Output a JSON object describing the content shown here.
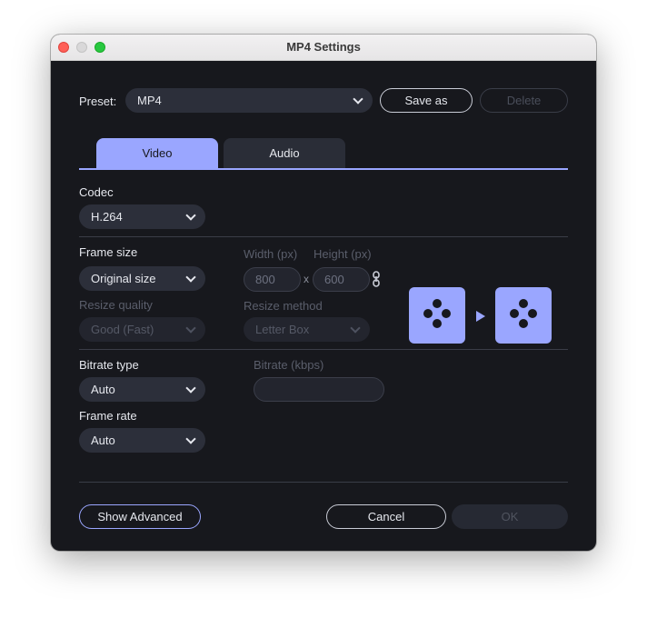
{
  "window": {
    "title": "MP4 Settings"
  },
  "preset": {
    "label": "Preset:",
    "value": "MP4",
    "save_as": "Save as",
    "delete": "Delete"
  },
  "tabs": [
    {
      "label": "Video",
      "active": true
    },
    {
      "label": "Audio",
      "active": false
    }
  ],
  "codec": {
    "label": "Codec",
    "value": "H.264"
  },
  "frame_size": {
    "label": "Frame size",
    "value": "Original size",
    "width_label": "Width (px)",
    "height_label": "Height (px)",
    "width": "800",
    "times": "x",
    "height": "600"
  },
  "resize_quality": {
    "label": "Resize quality",
    "value": "Good (Fast)"
  },
  "resize_method": {
    "label": "Resize method",
    "value": "Letter Box"
  },
  "bitrate_type": {
    "label": "Bitrate type",
    "value": "Auto"
  },
  "bitrate": {
    "label": "Bitrate (kbps)",
    "value": ""
  },
  "frame_rate": {
    "label": "Frame rate",
    "value": "Auto"
  },
  "footer": {
    "show_advanced": "Show Advanced",
    "cancel": "Cancel",
    "ok": "OK"
  },
  "colors": {
    "accent": "#9aa6ff",
    "background": "#17181d",
    "control": "#2c2f3a"
  },
  "icons": [
    "chevron-down-icon",
    "link-icon",
    "play-arrow-icon"
  ]
}
